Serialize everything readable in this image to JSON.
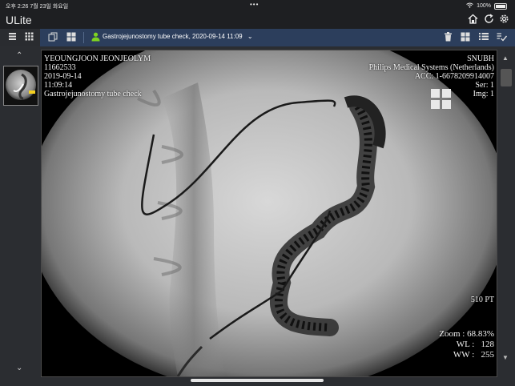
{
  "status_bar": {
    "time": "오후 2:26",
    "date": "7월 23일 화요일",
    "dots": "•••",
    "battery": "100%"
  },
  "app": {
    "logo_main": "U",
    "logo_rest": "Lite",
    "logo_dot": "i"
  },
  "toolbar": {
    "study_title": "Gastrojejunostomy tube check, 2020-09-14 11:09"
  },
  "overlay": {
    "patient_name": "YEOUNGJOON JEONJEOLYM",
    "patient_id": "11662533",
    "study_date": "2019-09-14",
    "study_time": "11:09:14",
    "study_desc": "Gastrojejunostomy tube check",
    "institution": "SNUBH",
    "manufacturer": "Philips Medical Systems (Netherlands)",
    "accession": "ACC: 1-6678209914007",
    "series": "Ser: 1",
    "image": "Img: 1",
    "orientation": "510 PT",
    "zoom": "Zoom : 68.83%",
    "wl_label": "WL :",
    "wl_value": "128",
    "ww_label": "WW :",
    "ww_value": "255"
  },
  "colors": {
    "toolbar_bg": "#2c3e5c",
    "accent": "#7ed321",
    "logo_accent": "#f5a623"
  }
}
